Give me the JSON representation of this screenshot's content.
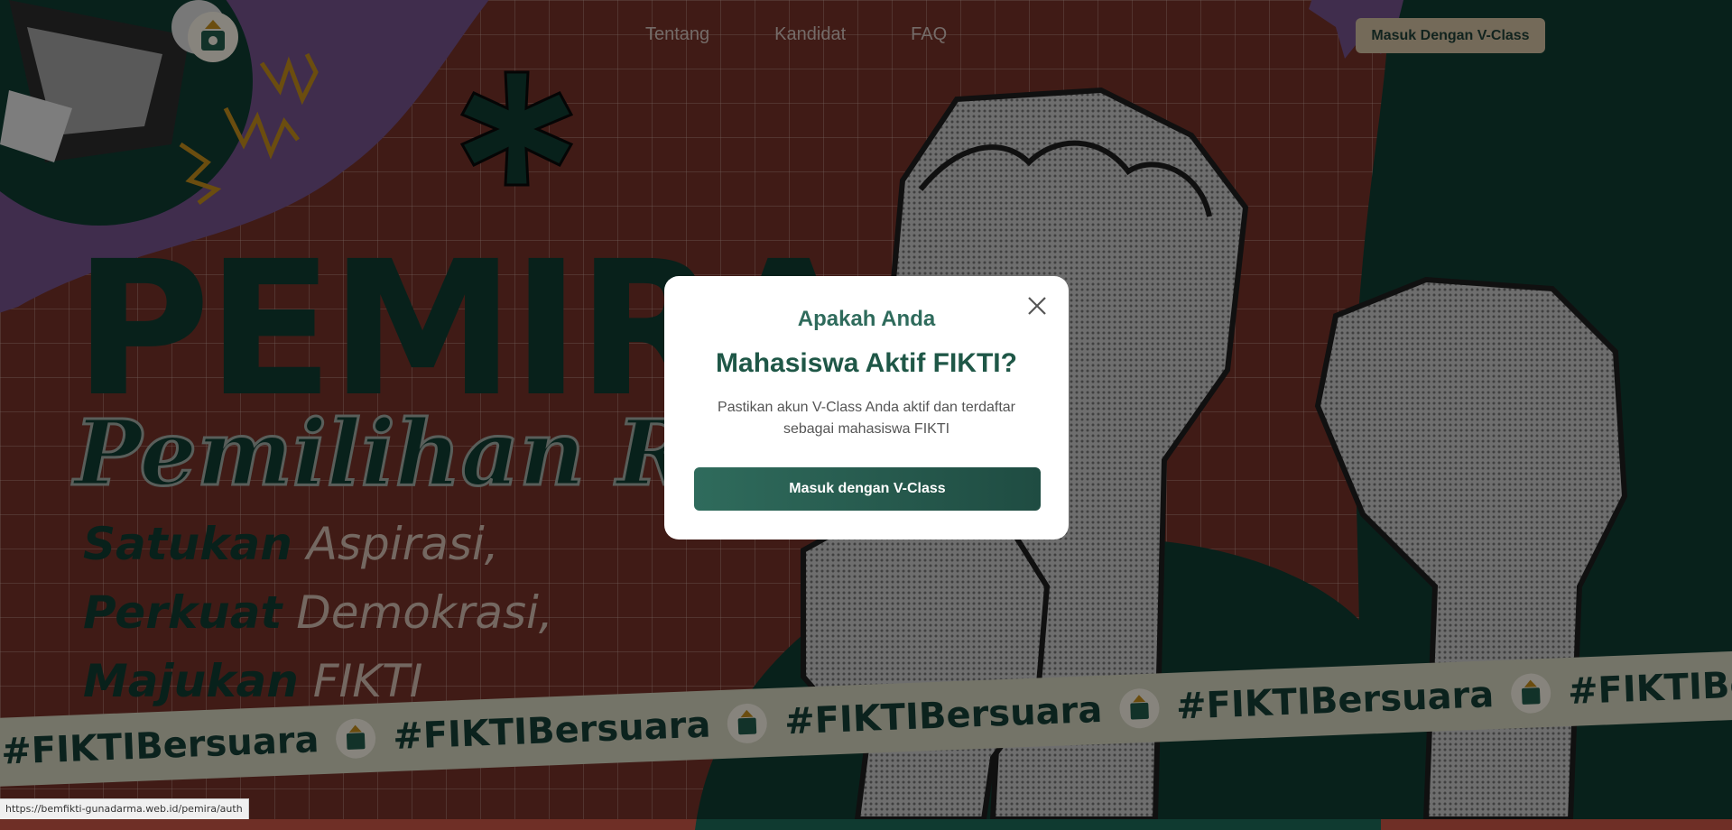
{
  "nav": {
    "items": [
      {
        "label": "Tentang"
      },
      {
        "label": "Kandidat"
      },
      {
        "label": "FAQ"
      }
    ],
    "login_label": "Masuk Dengan V-Class"
  },
  "hero": {
    "title": "PEMIRA",
    "subtitle": "Pemilihan Raya",
    "taglines": [
      {
        "dark": "Satukan",
        "light": "Aspirasi,"
      },
      {
        "dark": "Perkuat",
        "light": "Demokrasi,"
      },
      {
        "dark": "Majukan",
        "light": "FIKTI"
      }
    ]
  },
  "banner": {
    "hashtag": "#FIKTIBersuara"
  },
  "modal": {
    "eyebrow": "Apakah Anda",
    "title": "Mahasiswa Aktif FIKTI?",
    "description": "Pastikan akun V-Class Anda aktif dan terdaftar sebagai mahasiswa FIKTI",
    "button_label": "Masuk dengan V-Class",
    "close_icon": "close-icon"
  },
  "status_bar": {
    "url": "https://bemfikti-gunadarma.web.id/pemira/auth"
  },
  "colors": {
    "background": "#6f2f26",
    "dark_green": "#0f3a30",
    "purple": "#7a5a9e",
    "accent_tan": "#c8b79a",
    "modal_button": "#2f6b5c"
  }
}
